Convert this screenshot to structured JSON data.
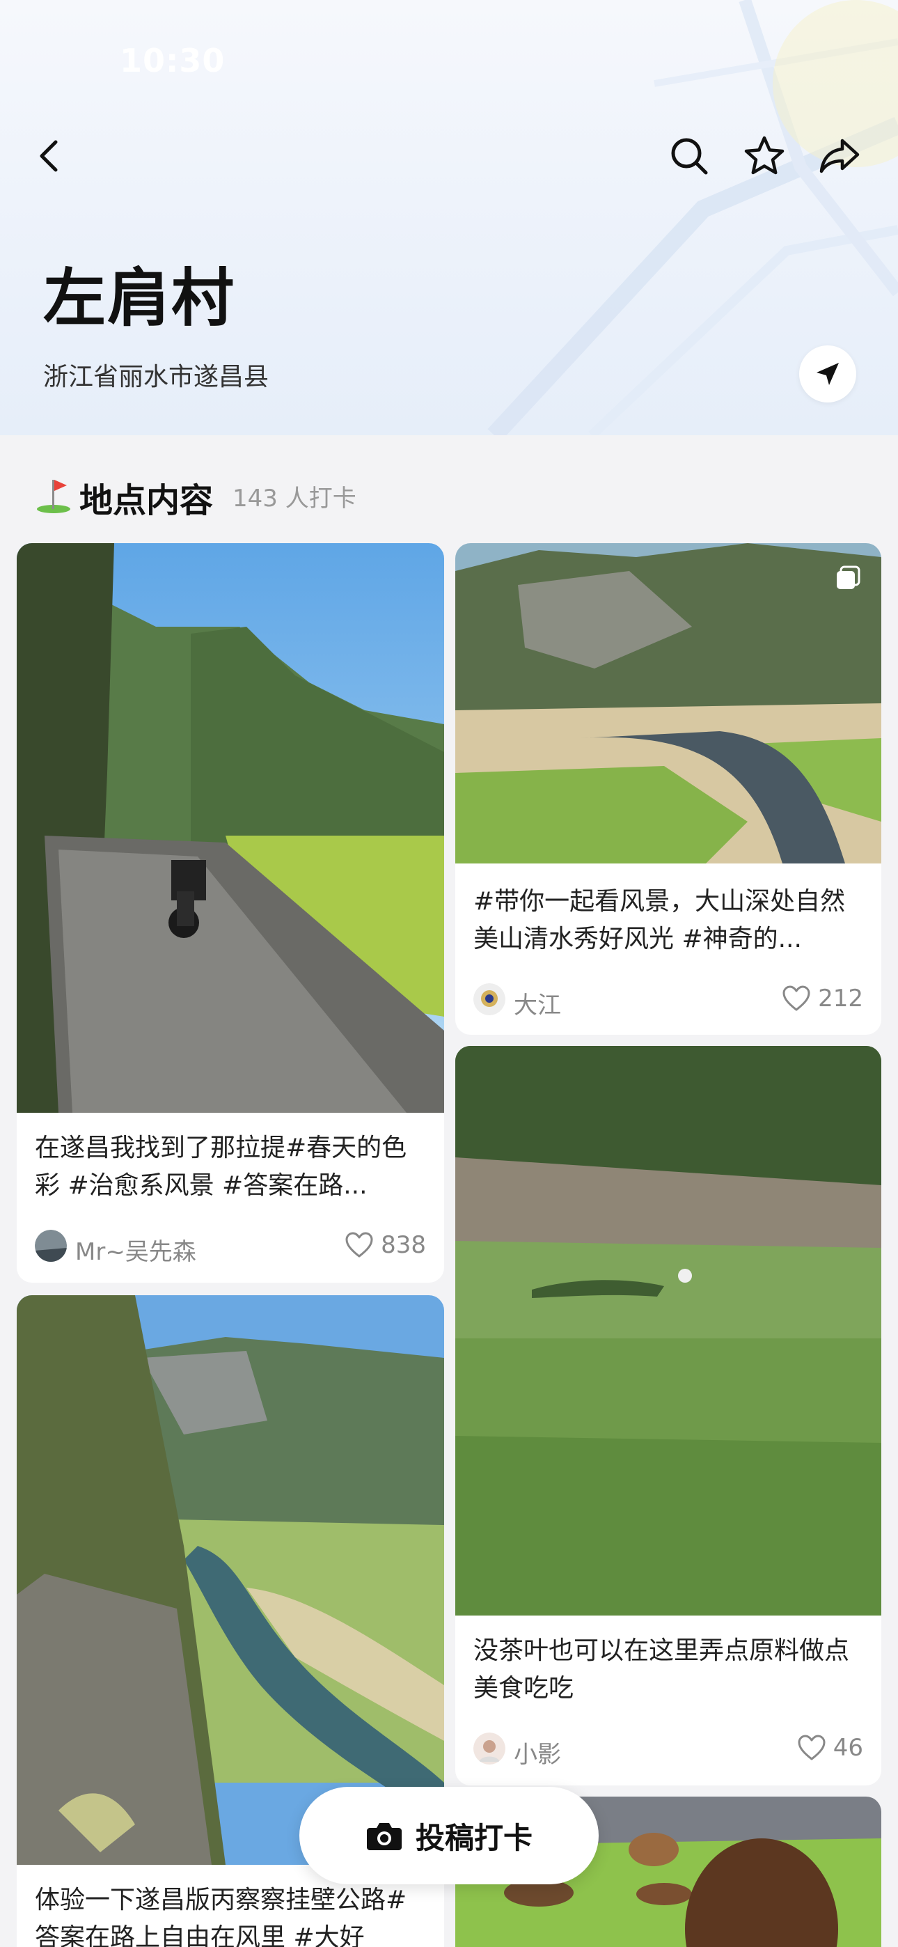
{
  "status_bar": {
    "time": "10:30"
  },
  "place": {
    "name": "左肩村",
    "address": "浙江省丽水市遂昌县"
  },
  "nav": {
    "back_icon": "chevron-left-icon",
    "search_icon": "search-icon",
    "favorite_icon": "star-icon",
    "share_icon": "share-icon",
    "locate_icon": "navigation-arrow-icon"
  },
  "section": {
    "title": "地点内容",
    "count": "143 人打卡"
  },
  "posts": [
    {
      "text": "在遂昌我找到了那拉提#春天的色彩 #治愈系风景 #答案在路...",
      "author": "Mr~吴先森",
      "likes": "838"
    },
    {
      "text": "#带你一起看风景，大山深处自然美山清水秀好风光 #神奇的...",
      "author": "大江",
      "likes": "212"
    },
    {
      "text": "没茶叶也可以在这里弄点原料做点美食吃吃",
      "author": "小影",
      "likes": "46"
    },
    {
      "text": "体验一下遂昌版丙察察挂壁公路#答案在路上自由在风里 #大好"
    }
  ],
  "post_button": {
    "label": "投稿打卡",
    "icon": "camera-icon"
  },
  "colors": {
    "background": "#f3f3f5",
    "card": "#ffffff",
    "text_primary": "#111111",
    "text_secondary": "#888888"
  }
}
